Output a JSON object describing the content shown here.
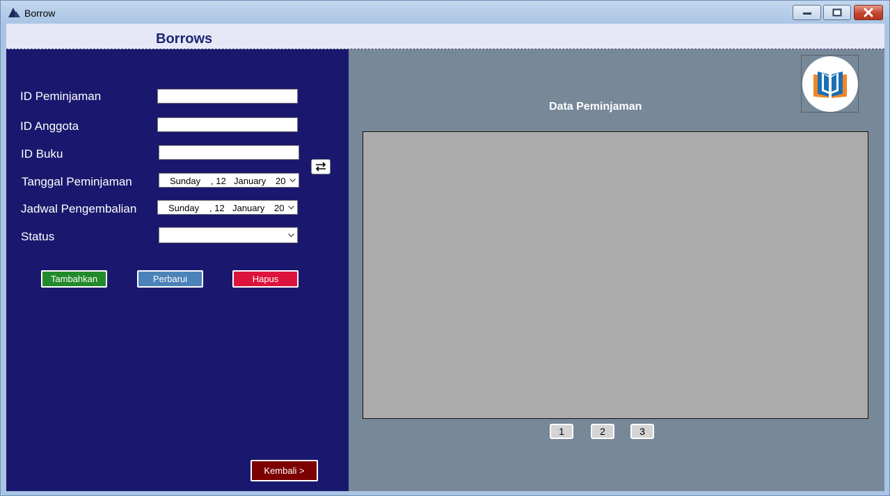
{
  "window": {
    "title": "Borrow"
  },
  "header": {
    "title": "Borrows"
  },
  "form": {
    "fields": [
      {
        "label": "ID Peminjaman",
        "value": ""
      },
      {
        "label": "ID Anggota",
        "value": ""
      },
      {
        "label": "ID Buku",
        "value": ""
      }
    ],
    "loan_date": {
      "label": "Tanggal Peminjaman",
      "day": "Sunday",
      "date": ", 12",
      "month": "January",
      "year": "20"
    },
    "return_date": {
      "label": "Jadwal Pengembalian",
      "day": "Sunday",
      "date": ", 12",
      "month": "January",
      "year": "20"
    },
    "status": {
      "label": "Status",
      "value": ""
    }
  },
  "actions": {
    "add": "Tambahkan",
    "update": "Perbarui",
    "delete": "Hapus",
    "back": "Kembali >"
  },
  "data_panel": {
    "title": "Data Peminjaman",
    "pages": [
      "1",
      "2",
      "3"
    ]
  },
  "colors": {
    "left_panel": "#1a186e",
    "right_panel": "#778899",
    "add": "#228a2b",
    "update": "#4b82b8",
    "delete": "#dc143c",
    "back": "#7d0000"
  },
  "icons": {
    "app": "app-triangle-icon",
    "swap": "swap-arrows-icon",
    "logo": "open-book-logo",
    "dropdown": "chevron-down-icon"
  }
}
